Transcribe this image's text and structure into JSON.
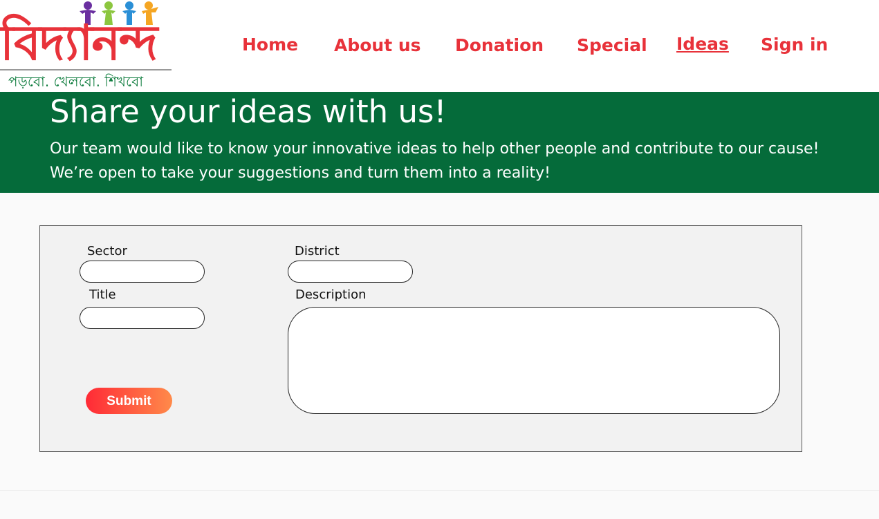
{
  "logo": {
    "name": "বিদ্যানন্দ",
    "tagline": "পড়বো. খেলবো. শিখবো"
  },
  "nav": [
    {
      "label": "Home"
    },
    {
      "label": "About us"
    },
    {
      "label": "Donation"
    },
    {
      "label": "Special"
    },
    {
      "label": "Ideas",
      "active": true
    },
    {
      "label": "Sign in"
    }
  ],
  "banner": {
    "title": "Share your ideas with us!",
    "text": "Our team would like to know your innovative ideas to help other people and contribute to our cause! We’re open to take your suggestions and turn them into a reality!"
  },
  "form": {
    "sector_label": "Sector",
    "district_label": "District",
    "title_label": "Title",
    "description_label": "Description",
    "submit_label": "Submit"
  },
  "colors": {
    "brand_red": "#e8323a",
    "banner_green": "#056b3a"
  }
}
